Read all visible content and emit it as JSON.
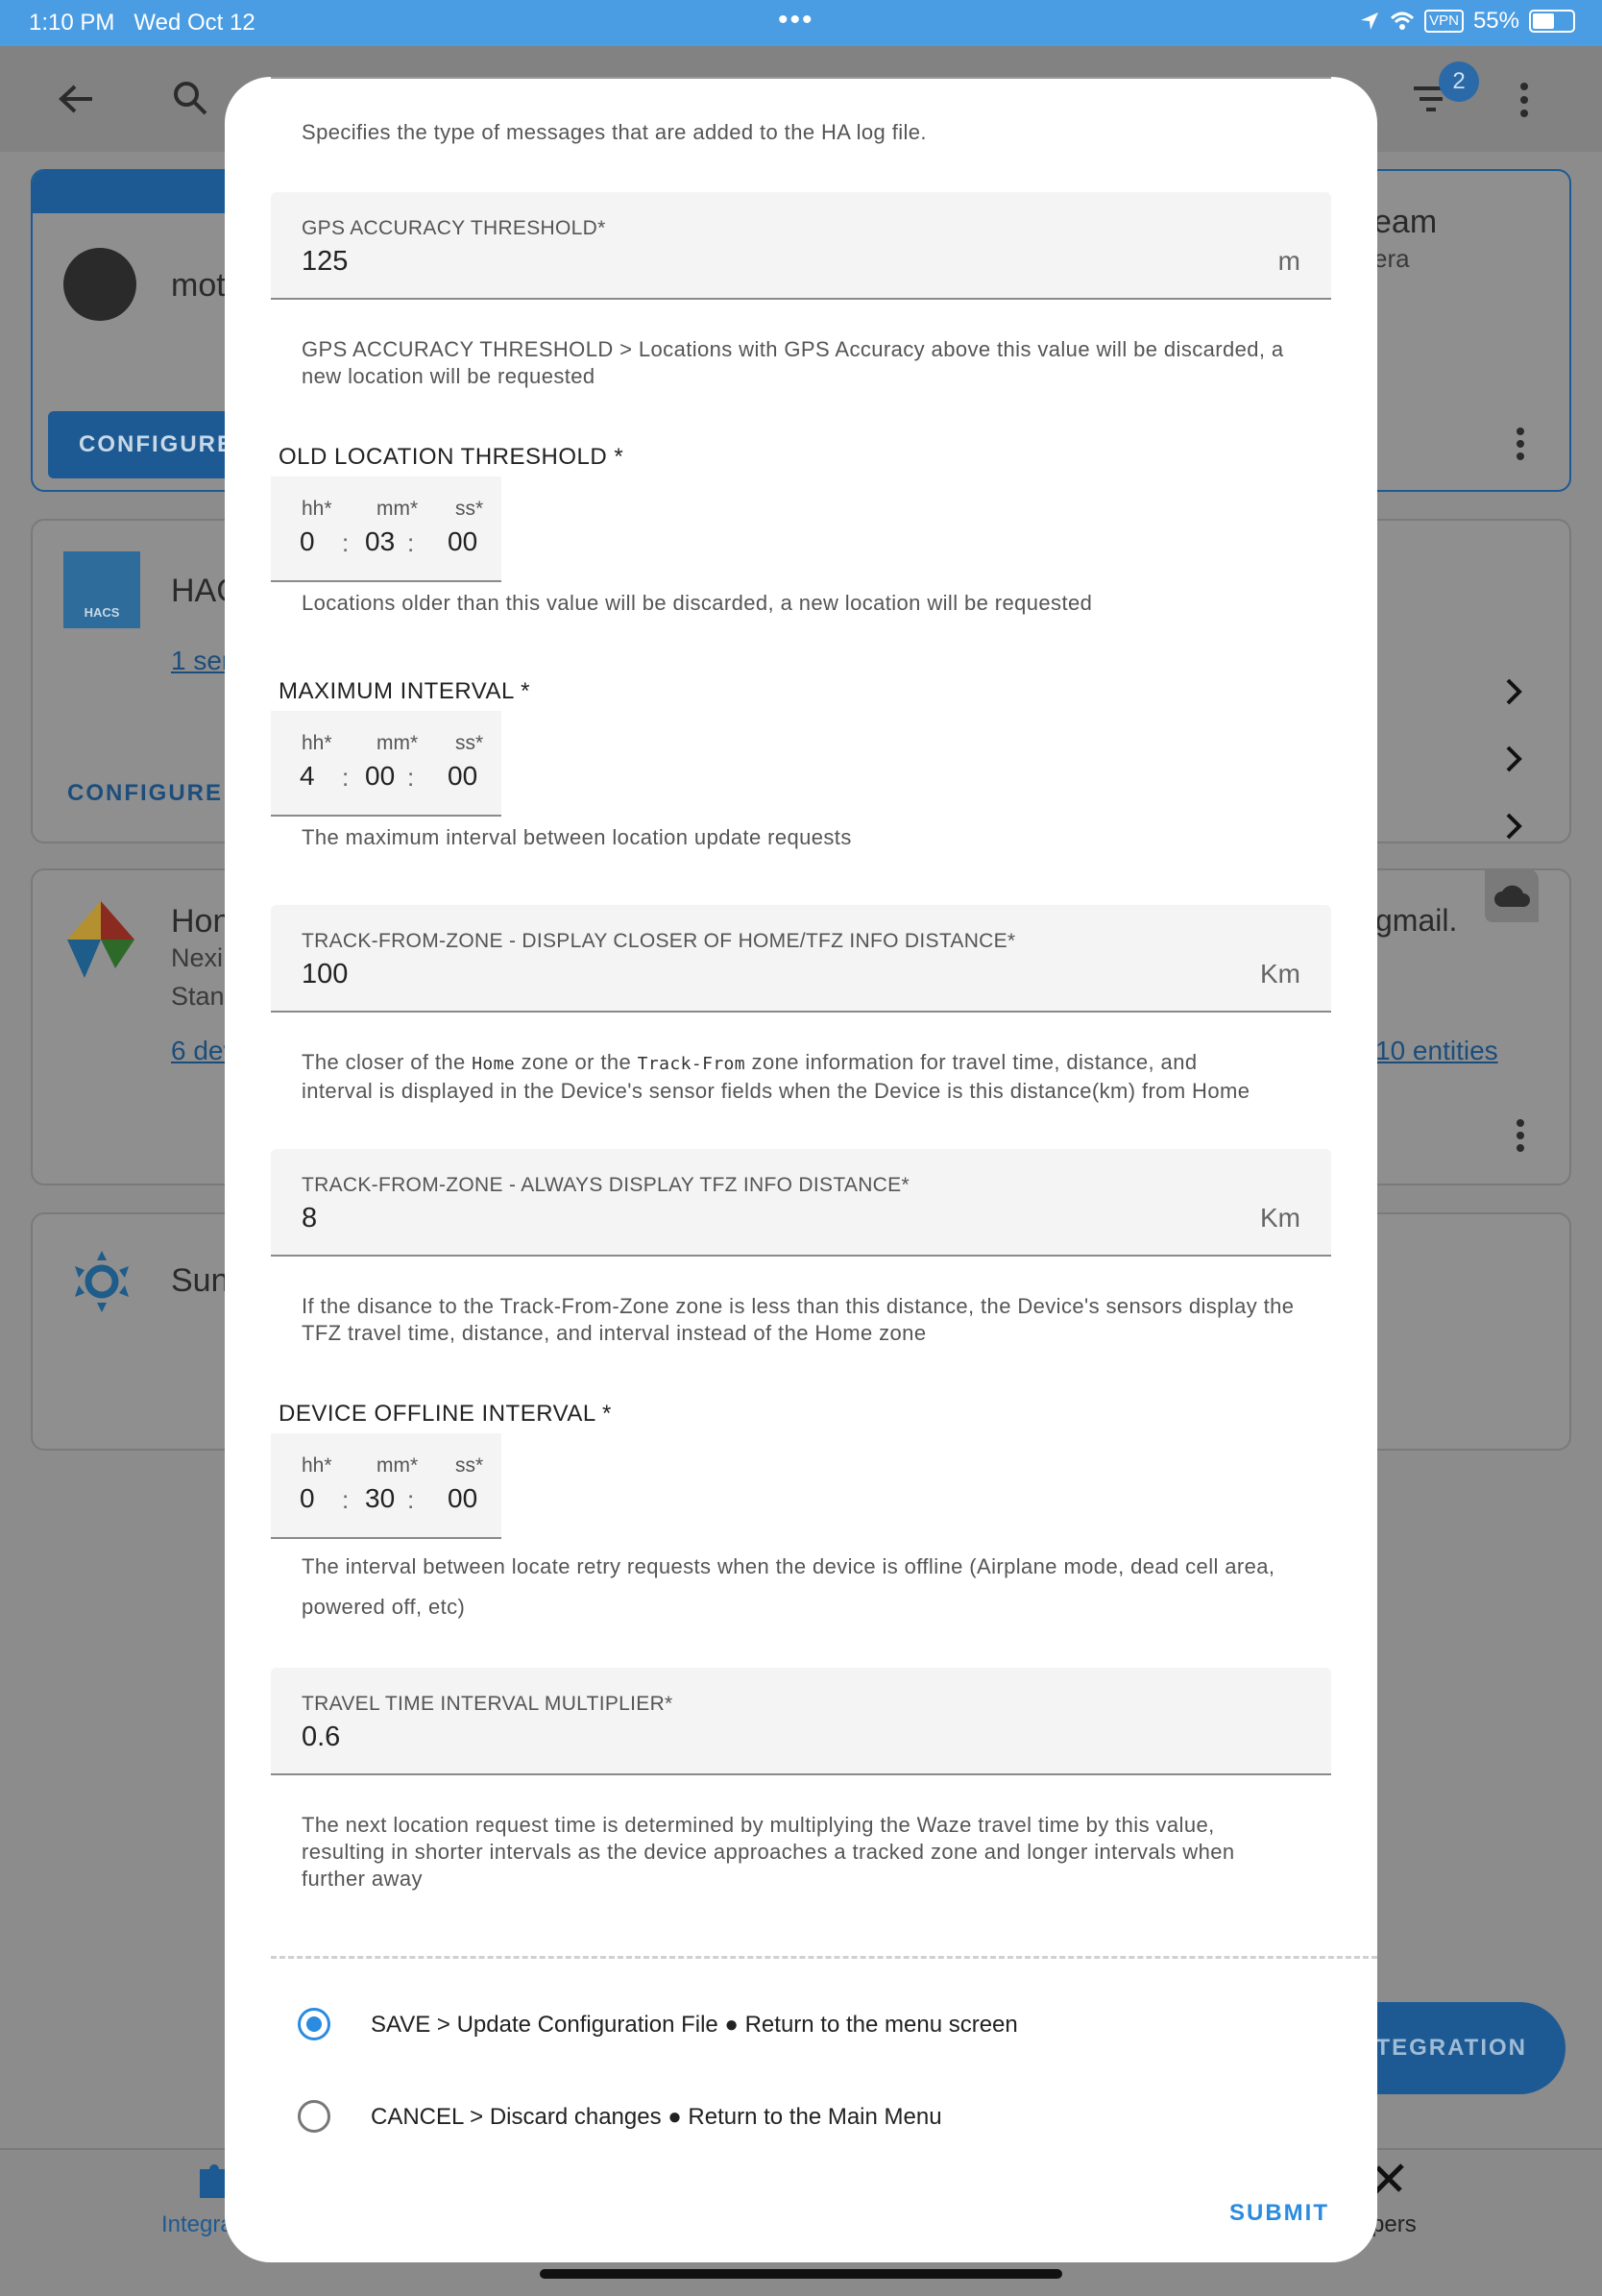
{
  "status_bar": {
    "time": "1:10 PM",
    "date": "Wed Oct 12",
    "vpn": "VPN",
    "battery": "55%"
  },
  "background": {
    "filter_badge": "2",
    "card1_label": "mot",
    "card1_configure": "CONFIGURE",
    "card1_right_title": "eam",
    "card1_right_sub": "era",
    "hacs_title": "HAC",
    "hacs_icon_text": "HACS",
    "hacs_link": "1 ser",
    "hacs_configure": "CONFIGURE",
    "card3_title": "Hon",
    "card3_line2": "Nexi",
    "card3_line3": "Stan",
    "card3_link": "6 dev",
    "card3_right_email": "gmail.",
    "card3_right_link": "10 entities",
    "card4_title": "Sun",
    "fab_label": "NTEGRATION",
    "nav_left_label": "Integra",
    "nav_right_label": "pers"
  },
  "dialog": {
    "log_helper": "Specifies the type of messages that are added to the HA log file.",
    "gps": {
      "label": "GPS ACCURACY THRESHOLD*",
      "value": "125",
      "unit": "m",
      "helper": "GPS ACCURACY THRESHOLD > Locations with GPS Accuracy above this value will be discarded, a new location will be requested"
    },
    "old_location": {
      "title": "OLD LOCATION THRESHOLD *",
      "hh_label": "hh*",
      "mm_label": "mm*",
      "ss_label": "ss*",
      "hh": "0",
      "mm": "03",
      "ss": "00",
      "helper": "Locations older than this value will be discarded, a new location will be requested"
    },
    "max_interval": {
      "title": "MAXIMUM INTERVAL *",
      "hh_label": "hh*",
      "mm_label": "mm*",
      "ss_label": "ss*",
      "hh": "4",
      "mm": "00",
      "ss": "00",
      "helper": "The maximum interval between location update requests"
    },
    "tfz_closer": {
      "label": "TRACK-FROM-ZONE - DISPLAY CLOSER OF HOME/TFZ INFO DISTANCE*",
      "value": "100",
      "unit": "Km",
      "helper_a": "The closer of the",
      "code_home": "Home",
      "helper_b": "zone or the",
      "code_tfz": "Track-From",
      "helper_c": "zone information for travel time, distance, and",
      "helper_line2": "interval is displayed in the Device's sensor fields when the Device is this distance(km) from Home"
    },
    "tfz_always": {
      "label": "TRACK-FROM-ZONE - ALWAYS DISPLAY TFZ INFO DISTANCE*",
      "value": "8",
      "unit": "Km",
      "helper": "If the disance to the Track-From-Zone zone is less than this distance, the Device's sensors display the TFZ travel time, distance, and interval instead of the Home zone"
    },
    "offline": {
      "title": "DEVICE OFFLINE INTERVAL *",
      "hh_label": "hh*",
      "mm_label": "mm*",
      "ss_label": "ss*",
      "hh": "0",
      "mm": "30",
      "ss": "00",
      "helper": "The interval between locate retry requests when the device is offline (Airplane mode, dead cell area, powered off, etc)"
    },
    "travel": {
      "label": "TRAVEL TIME INTERVAL MULTIPLIER*",
      "value": "0.6",
      "helper": "The next location request time is determined by multiplying the Waze travel time by this value, resulting in shorter intervals as the device approaches a tracked zone and longer intervals when further away"
    },
    "options": [
      {
        "label": "SAVE > Update Configuration File ● Return to the menu screen",
        "selected": true
      },
      {
        "label": "CANCEL > Discard changes ● Return to the Main Menu",
        "selected": false
      }
    ],
    "submit": "SUBMIT"
  }
}
